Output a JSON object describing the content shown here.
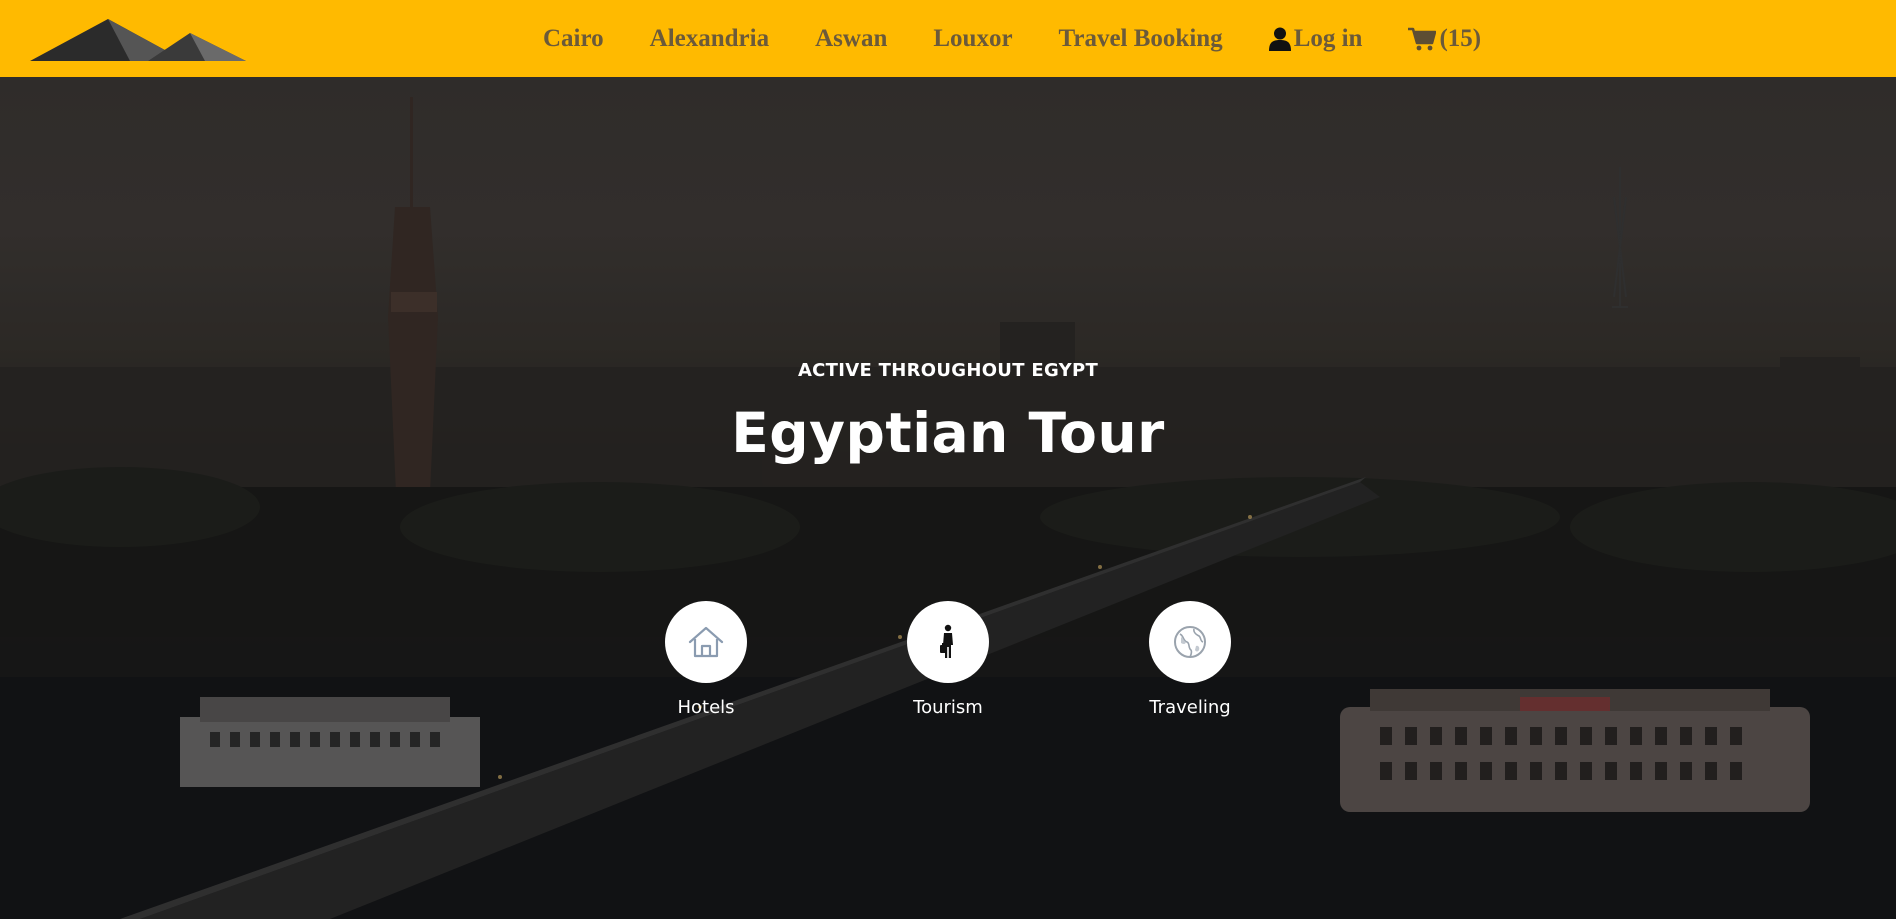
{
  "nav": {
    "logo_icon": "pyramids-logo-icon",
    "links": [
      {
        "label": "Cairo"
      },
      {
        "label": "Alexandria"
      },
      {
        "label": "Aswan"
      },
      {
        "label": "Louxor"
      },
      {
        "label": "Travel Booking"
      },
      {
        "label": "Log in",
        "icon": "user-icon"
      },
      {
        "label": "(15)",
        "icon": "cart-icon"
      }
    ]
  },
  "hero": {
    "eyebrow": "ACTIVE THROUGHOUT EGYPT",
    "title": "Egyptian Tour",
    "features": [
      {
        "label": "Hotels",
        "icon": "home-icon"
      },
      {
        "label": "Tourism",
        "icon": "traveler-icon"
      },
      {
        "label": "Traveling",
        "icon": "globe-icon"
      }
    ]
  },
  "colors": {
    "navbar_bg": "#ffba00",
    "nav_text": "#6b5a3a",
    "hero_text": "#ffffff"
  }
}
